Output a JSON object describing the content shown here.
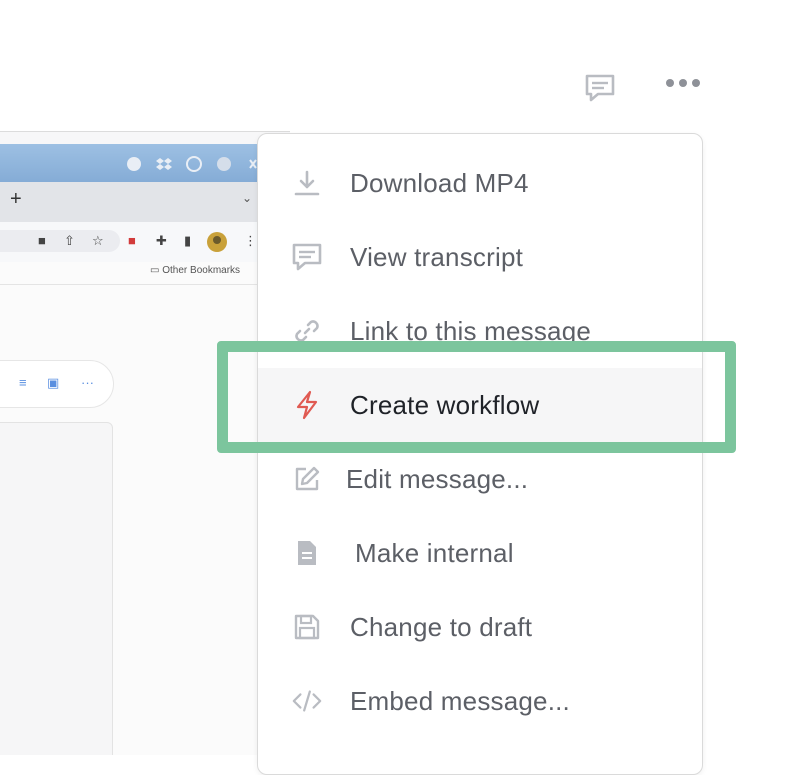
{
  "browser_screenshot": {
    "bookmarks_label": "Other Bookmarks"
  },
  "menu": {
    "items": [
      {
        "label": "Download MP4",
        "icon": "download-icon"
      },
      {
        "label": "View transcript",
        "icon": "transcript-icon"
      },
      {
        "label": "Link to this message",
        "icon": "link-icon"
      },
      {
        "label": "Create workflow",
        "icon": "lightning-icon",
        "highlighted": true
      },
      {
        "label": "Edit message...",
        "icon": "pencil-icon"
      },
      {
        "label": "Make internal",
        "icon": "document-icon"
      },
      {
        "label": "Change to draft",
        "icon": "floppy-disk-icon"
      },
      {
        "label": "Embed message...",
        "icon": "code-icon"
      }
    ]
  },
  "colors": {
    "highlight": "#7cc59d",
    "lightning_icon": "#e05a52",
    "menu_text": "#5c5f66",
    "icon_gray": "#b9bcc2"
  }
}
